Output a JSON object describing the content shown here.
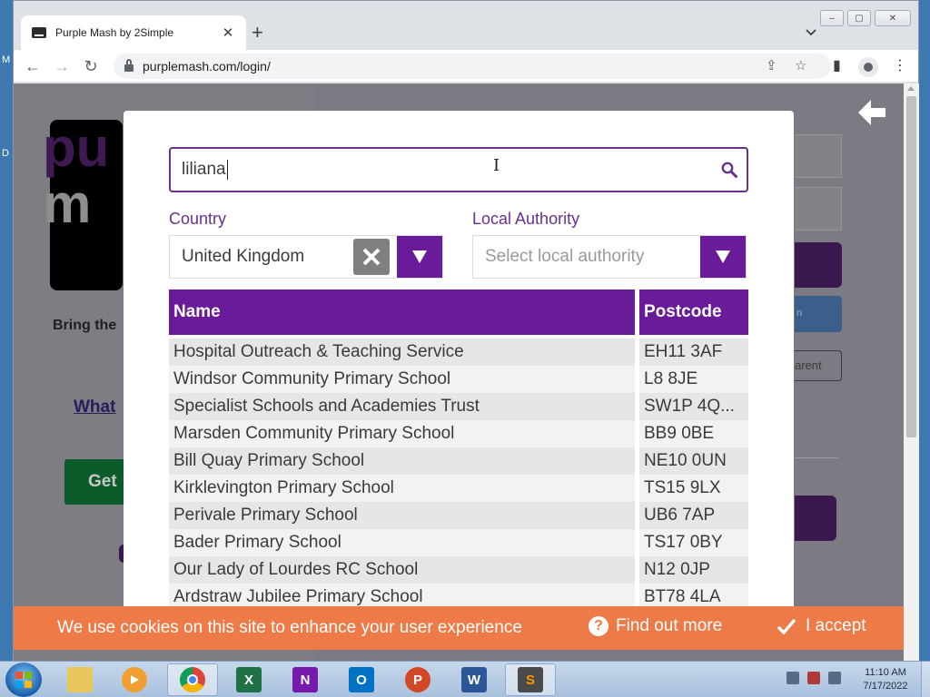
{
  "desktop": {
    "letter_top": "M",
    "letter_mid": "D"
  },
  "browser": {
    "tab": {
      "title": "Purple Mash by 2Simple",
      "close": "✕"
    },
    "new_tab": "+",
    "tab_search": "⌄",
    "window_controls": {
      "minimize": "‒",
      "maximize": "▢",
      "close": "✕"
    },
    "nav": {
      "back": "←",
      "forward": "→",
      "reload": "↻"
    },
    "url": "purplemash.com/login/",
    "icons": {
      "share": "⇪",
      "bookmark": "☆",
      "side_panel": "▮",
      "menu": "⋮"
    }
  },
  "background_page": {
    "logo_line1": "pu",
    "logo_line2": "m",
    "tagline": "Bring the",
    "link": "What",
    "get_button": "Get",
    "right_blue_text": "n",
    "right_outline_text": "arent"
  },
  "modal": {
    "search": {
      "value": "liliana"
    },
    "country": {
      "label": "Country",
      "value": "United Kingdom"
    },
    "local_authority": {
      "label": "Local Authority",
      "placeholder": "Select local authority"
    },
    "table": {
      "headers": {
        "name": "Name",
        "postcode": "Postcode"
      },
      "rows": [
        {
          "name": "Hospital Outreach & Teaching Service",
          "postcode": "EH11 3AF"
        },
        {
          "name": "Windsor Community Primary School",
          "postcode": "L8 8JE"
        },
        {
          "name": "Specialist Schools and Academies Trust",
          "postcode": "SW1P 4Q..."
        },
        {
          "name": "Marsden Community Primary School",
          "postcode": "BB9 0BE"
        },
        {
          "name": "Bill Quay Primary School",
          "postcode": "NE10 0UN"
        },
        {
          "name": "Kirklevington Primary School",
          "postcode": "TS15 9LX"
        },
        {
          "name": "Perivale Primary School",
          "postcode": "UB6 7AP"
        },
        {
          "name": "Bader Primary School",
          "postcode": "TS17 0BY"
        },
        {
          "name": "Our Lady of Lourdes RC School",
          "postcode": "N12 0JP"
        },
        {
          "name": "Ardstraw Jubilee Primary School",
          "postcode": "BT78 4LA"
        }
      ]
    }
  },
  "cookie_bar": {
    "message": "We use cookies on this site to enhance your user experience",
    "find_out_more": "Find out more",
    "accept": "I accept",
    "q_glyph": "?"
  },
  "taskbar": {
    "apps": [
      {
        "name": "file-explorer",
        "glyph": ""
      },
      {
        "name": "media-player",
        "glyph": ""
      },
      {
        "name": "chrome",
        "glyph": ""
      },
      {
        "name": "excel",
        "glyph": "X"
      },
      {
        "name": "onenote",
        "glyph": "N"
      },
      {
        "name": "outlook",
        "glyph": "O"
      },
      {
        "name": "powerpoint",
        "glyph": "P"
      },
      {
        "name": "word",
        "glyph": "W"
      },
      {
        "name": "sublime-text",
        "glyph": "S"
      }
    ],
    "clock": {
      "time": "11:10 AM",
      "date": "7/17/2022"
    }
  },
  "colors": {
    "brand_purple": "#6a1b9a",
    "cookie_orange": "#ee7a48"
  }
}
